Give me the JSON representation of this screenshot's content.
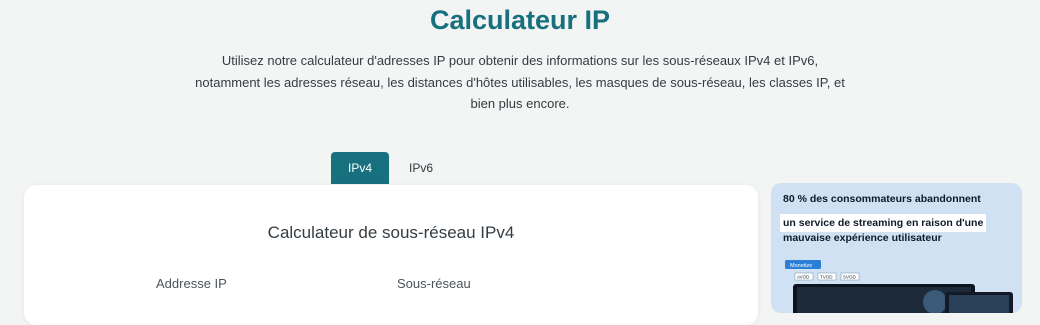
{
  "header": {
    "title": "Calculateur IP",
    "intro_lines": [
      "Utilisez notre calculateur d'adresses IP pour obtenir des informations sur les sous-réseaux IPv4 et IPv6,",
      "notamment les adresses réseau, les distances d'hôtes utilisables, les masques de sous-réseau, les classes IP, et",
      "bien plus encore."
    ]
  },
  "tabs": [
    {
      "label": "IPv4",
      "active": true
    },
    {
      "label": "IPv6",
      "active": false
    }
  ],
  "calculator": {
    "title": "Calculateur de sous-réseau IPv4",
    "ip_label": "Addresse IP",
    "subnet_label": "Sous-réseau"
  },
  "ad": {
    "line1": "80 % des consommateurs abandonnent",
    "line2": "un service de streaming en raison d'une",
    "line3": "mauvaise expérience utilisateur",
    "badge": "Monetize",
    "chips": [
      "AVOD",
      "TVOD",
      "SVOD"
    ]
  },
  "colors": {
    "accent": "#17707e",
    "background": "#f3f4f4",
    "ad_background": "#cfe1f2"
  }
}
